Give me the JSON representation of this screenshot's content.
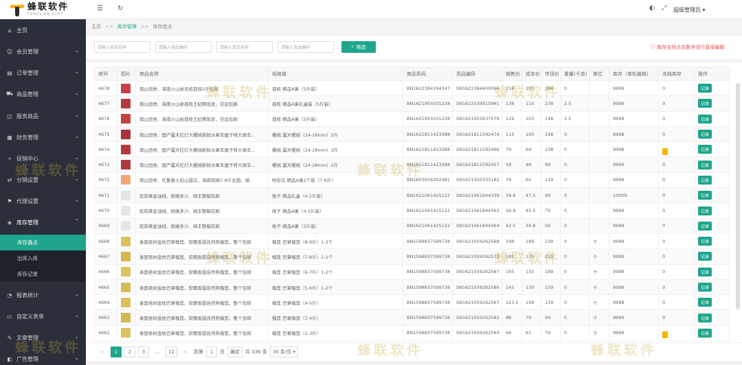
{
  "logo": {
    "cn": "蜂联软件",
    "en": "FENGLIAN SOFT"
  },
  "header": {
    "user": "超级管理员"
  },
  "menu": [
    {
      "label": "主页",
      "icon": "home-icon"
    },
    {
      "label": "会员管理",
      "icon": "users-icon"
    },
    {
      "label": "订单管理",
      "icon": "order-icon"
    },
    {
      "label": "商品管理",
      "icon": "cart-icon"
    },
    {
      "label": "服务商品",
      "icon": "service-icon"
    },
    {
      "label": "财务管理",
      "icon": "finance-icon"
    },
    {
      "label": "促销中心",
      "icon": "promo-icon"
    },
    {
      "label": "分销设置",
      "icon": "share-icon"
    },
    {
      "label": "代理设置",
      "icon": "agent-icon"
    },
    {
      "label": "库存管理",
      "icon": "stock-icon"
    }
  ],
  "submenu": [
    {
      "label": "库存盘点"
    },
    {
      "label": "出库入库"
    },
    {
      "label": "库存记录"
    }
  ],
  "menu_bottom": [
    {
      "label": "报表统计",
      "icon": "report-icon"
    },
    {
      "label": "自定义表单",
      "icon": "form-icon"
    },
    {
      "label": "文章管理",
      "icon": "article-icon"
    },
    {
      "label": "广告管理",
      "icon": "ad-icon"
    }
  ],
  "breadcrumb": {
    "home": "主页",
    "sep": ">>",
    "level1": "库存管理",
    "level2": "库存盘点"
  },
  "filters": [
    {
      "placeholder": "请输入商品名称"
    },
    {
      "placeholder": "请输入商品编码"
    },
    {
      "placeholder": "请输入货品条码"
    },
    {
      "placeholder": "请输入货品编码"
    }
  ],
  "search_label": "筛选",
  "hint": "库存支持点击数字进行直接编辑",
  "columns": [
    "序列",
    "图片",
    "商品名称",
    "规格值",
    "商品条码",
    "货品编码",
    "销售价",
    "成本价",
    "市场价",
    "重量(千克)",
    "单位",
    "库存（单机编辑）",
    "冻结库存",
    "操作"
  ],
  "rows": [
    {
      "id": "4678",
      "color": "#c8414a",
      "name": "南山田舍、海南火山岩无核荔枝5斤包邮",
      "spec": "荔枝 精品A果（5斤装）",
      "barcode": "BN1622384194347",
      "sku": "SN1622384400066",
      "sale": "218",
      "cost": "203",
      "market": "388",
      "weight": "0",
      "unit": "",
      "stock": "9999",
      "frozen": "0",
      "flag": false
    },
    {
      "id": "4677",
      "color": "#b43a3f",
      "name": "南山田舍、海南火山岩荔枝王妃腾现发，空运包邮",
      "spec": "荔枝 精品A果礼盒装（5斤装）",
      "barcode": "BN1621955031238",
      "sku": "SN1622039915961",
      "sale": "138",
      "cost": "110",
      "market": "238",
      "weight": "2.5",
      "unit": "",
      "stock": "9999",
      "frozen": "0",
      "flag": false
    },
    {
      "id": "4676",
      "color": "#c2423f",
      "name": "南山田舍、海南火山岩荔枝王妃腾现发，空运包邮",
      "spec": "荔枝 精品A果（5斤装）",
      "barcode": "BN1621955031238",
      "sku": "SN1621955637079",
      "sale": "129",
      "cost": "103",
      "market": "198",
      "weight": "2.5",
      "unit": "",
      "stock": "9999",
      "frozen": "0",
      "flag": false
    },
    {
      "id": "4675",
      "color": "#a83238",
      "name": "南山田舍、国产露天红灯大樱桃新鲜水果车厘子特大顺丰...",
      "spec": "樱桃 露天樱桃（24-28mm）5斤",
      "barcode": "BN1621811423388",
      "sku": "SN1621811592474",
      "sale": "115",
      "cost": "100",
      "market": "198",
      "weight": "0",
      "unit": "",
      "stock": "9998",
      "frozen": "0",
      "flag": false
    },
    {
      "id": "4674",
      "color": "#b8363d",
      "name": "南山田舍、国产露天红灯大樱桃新鲜水果车厘子特大顺丰...",
      "spec": "樱桃 露天樱桃（24-28mm）3斤",
      "barcode": "BN1621811423388",
      "sku": "SN1621811592466",
      "sale": "79",
      "cost": "69",
      "market": "138",
      "weight": "0",
      "unit": "",
      "stock": "9998",
      "frozen": "1",
      "flag": true
    },
    {
      "id": "4673",
      "color": "#ad3a40",
      "name": "南山田舍、国产露天红灯大樱桃新鲜水果车厘子特大顺丰...",
      "spec": "樱桃 露天樱桃（24-28mm）2斤",
      "barcode": "BN1621811423388",
      "sku": "SN1621811592457",
      "sale": "59",
      "cost": "48",
      "market": "99",
      "weight": "0",
      "unit": "",
      "stock": "9999",
      "frozen": "0",
      "flag": false
    },
    {
      "id": "4672",
      "color": "#f0a878",
      "name": "南山田舍、吐鲁番火焰山甜瓜、海南现摘7-8斤全国、顺...",
      "spec": "哈密瓜 精品A果2个装（7-8斤）",
      "barcode": "BN1603934302481",
      "sku": "SN1621350333182",
      "sale": "79",
      "cost": "65",
      "market": "119",
      "weight": "0",
      "unit": "",
      "stock": "9999",
      "frozen": "0",
      "flag": false
    },
    {
      "id": "4671",
      "color": "#e6e6e6",
      "name": "民族黄金油桃、鲜嫩多汁、顺丰整箱包邮",
      "spec": "桃子 精品礼盒（4.5斤装）",
      "barcode": "BN1621061425122",
      "sku": "SN1621061844339",
      "sale": "59.8",
      "cost": "47.5",
      "market": "99",
      "weight": "0",
      "unit": "",
      "stock": "10009",
      "frozen": "0",
      "flag": false
    },
    {
      "id": "4670",
      "color": "#e6e6e6",
      "name": "民族黄金油桃、鲜嫩多汁、顺丰整箱包邮",
      "spec": "桃子 精品A果（4.5斤装）",
      "barcode": "BN1621061425122",
      "sku": "SN1621061844363",
      "sale": "56.8",
      "cost": "45.5",
      "market": "79",
      "weight": "0",
      "unit": "",
      "stock": "9999",
      "frozen": "0",
      "flag": false
    },
    {
      "id": "4669",
      "color": "#e6e6e6",
      "name": "民族黄金油桃、鲜嫩多汁、顺丰整箱包邮",
      "spec": "桃子 精品A果（3斤装）",
      "barcode": "BN1621061425122",
      "sku": "SN1621061844364",
      "sale": "42.5",
      "cost": "34.8",
      "market": "59",
      "weight": "0",
      "unit": "",
      "stock": "9999",
      "frozen": "0",
      "flag": false
    },
    {
      "id": "4668",
      "color": "#d9c05a",
      "name": "泰国老树金枕巴掌榴莲、软糯香甜自然熟榴莲，整个包邮",
      "spec": "榴莲 巴掌榴莲（8-9斤）1-3个",
      "barcode": "BN1598837599738",
      "sku": "SN1621059262568",
      "sale": "198",
      "cost": "189",
      "market": "238",
      "weight": "0",
      "unit": "个",
      "stock": "9999",
      "frozen": "0",
      "flag": false
    },
    {
      "id": "4667",
      "color": "#d4b84e",
      "name": "泰国老树金枕巴掌榴莲、软糯香甜自然熟榴莲，整个包邮",
      "spec": "榴莲 巴掌榴莲（7-8斤）1-2个",
      "barcode": "BN1598837599738",
      "sku": "SN1621059262573",
      "sale": "185",
      "cost": "170",
      "market": "210",
      "weight": "0",
      "unit": "个",
      "stock": "9999",
      "frozen": "0",
      "flag": false
    },
    {
      "id": "4666",
      "color": "#dcc260",
      "name": "泰国老树金枕巴掌榴莲、软糯香甜自然熟榴莲，整个包邮",
      "spec": "榴莲 巴掌榴莲（6-7斤）1-2个",
      "barcode": "BN1598837599738",
      "sku": "SN1621059262587",
      "sale": "165",
      "cost": "150",
      "market": "189",
      "weight": "0",
      "unit": "个",
      "stock": "9999",
      "frozen": "0",
      "flag": false
    },
    {
      "id": "4665",
      "color": "#d6bc55",
      "name": "泰国老树金枕巴掌榴莲、软糯香甜自然熟榴莲，整个包邮",
      "spec": "榴莲 巴掌榴莲（5-6斤）1-2个",
      "barcode": "BN1598837599738",
      "sku": "SN1621059262580",
      "sale": "143",
      "cost": "130",
      "market": "159",
      "weight": "0",
      "unit": "个",
      "stock": "9999",
      "frozen": "0",
      "flag": false
    },
    {
      "id": "4664",
      "color": "#d9c05a",
      "name": "泰国老树金枕巴掌榴莲、软糯香甜自然熟榴莲，整个包邮",
      "spec": "榴莲 巴掌榴莲（4-5斤）",
      "barcode": "BN1598837599738",
      "sku": "SN1621059262567",
      "sale": "123.5",
      "cost": "109",
      "market": "139",
      "weight": "0",
      "unit": "个",
      "stock": "9999",
      "frozen": "0",
      "flag": false
    },
    {
      "id": "4663",
      "color": "#d4b84e",
      "name": "泰国老树金枕巴掌榴莲、软糯香甜自然熟榴莲，整个包邮",
      "spec": "榴莲 巴掌榴莲（3-4斤）",
      "barcode": "BN1598837599738",
      "sku": "SN1621059262582",
      "sale": "88",
      "cost": "79",
      "market": "99",
      "weight": "0",
      "unit": "个",
      "stock": "9999",
      "frozen": "0",
      "flag": false
    },
    {
      "id": "4662",
      "color": "#dcc260",
      "name": "泰国老树金枕巴掌榴莲、软糯香甜自然熟榴莲，整个包邮",
      "spec": "榴莲 巴掌榴莲（2-3斤）",
      "barcode": "BN1598837599738",
      "sku": "SN1621059262564",
      "sale": "69",
      "cost": "61",
      "market": "79",
      "weight": "0",
      "unit": "个",
      "stock": "9999",
      "frozen": "1",
      "flag": true
    }
  ],
  "action_label": "记录",
  "pagination": {
    "pages": [
      "1",
      "2",
      "3",
      "...",
      "12"
    ],
    "goto_label": "到第",
    "goto_value": "1",
    "page_unit": "页",
    "confirm": "确定",
    "total": "共 336 条",
    "per_page": "30 条/页"
  },
  "watermark": "蜂联软件",
  "colors": {
    "accent": "#1fa58c",
    "sidebar": "#2b2f3a",
    "warn": "#e94e4e",
    "flag": "#f5b400"
  }
}
